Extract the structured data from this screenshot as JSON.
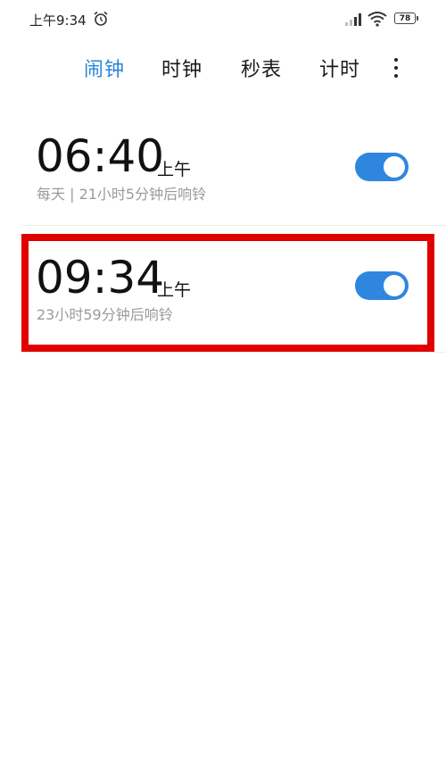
{
  "status_bar": {
    "time": "上午9:34",
    "battery": "78",
    "icons": [
      "alarm-clock-icon",
      "signal-icon",
      "wifi-icon",
      "battery-icon"
    ]
  },
  "tabs": [
    {
      "label": "闹钟",
      "active": true
    },
    {
      "label": "时钟",
      "active": false
    },
    {
      "label": "秒表",
      "active": false
    },
    {
      "label": "计时",
      "active": false
    }
  ],
  "alarms": [
    {
      "time": "06:40",
      "period": "上午",
      "subtitle": "每天 | 21小时5分钟后响铃",
      "enabled": true
    },
    {
      "time": "09:34",
      "period": "上午",
      "subtitle": "23小时59分钟后响铃",
      "enabled": true
    }
  ],
  "colors": {
    "accent": "#2a86d8",
    "toggle_on": "#2f86de",
    "highlight": "#e00000",
    "subtitle": "#9a9a9a"
  }
}
